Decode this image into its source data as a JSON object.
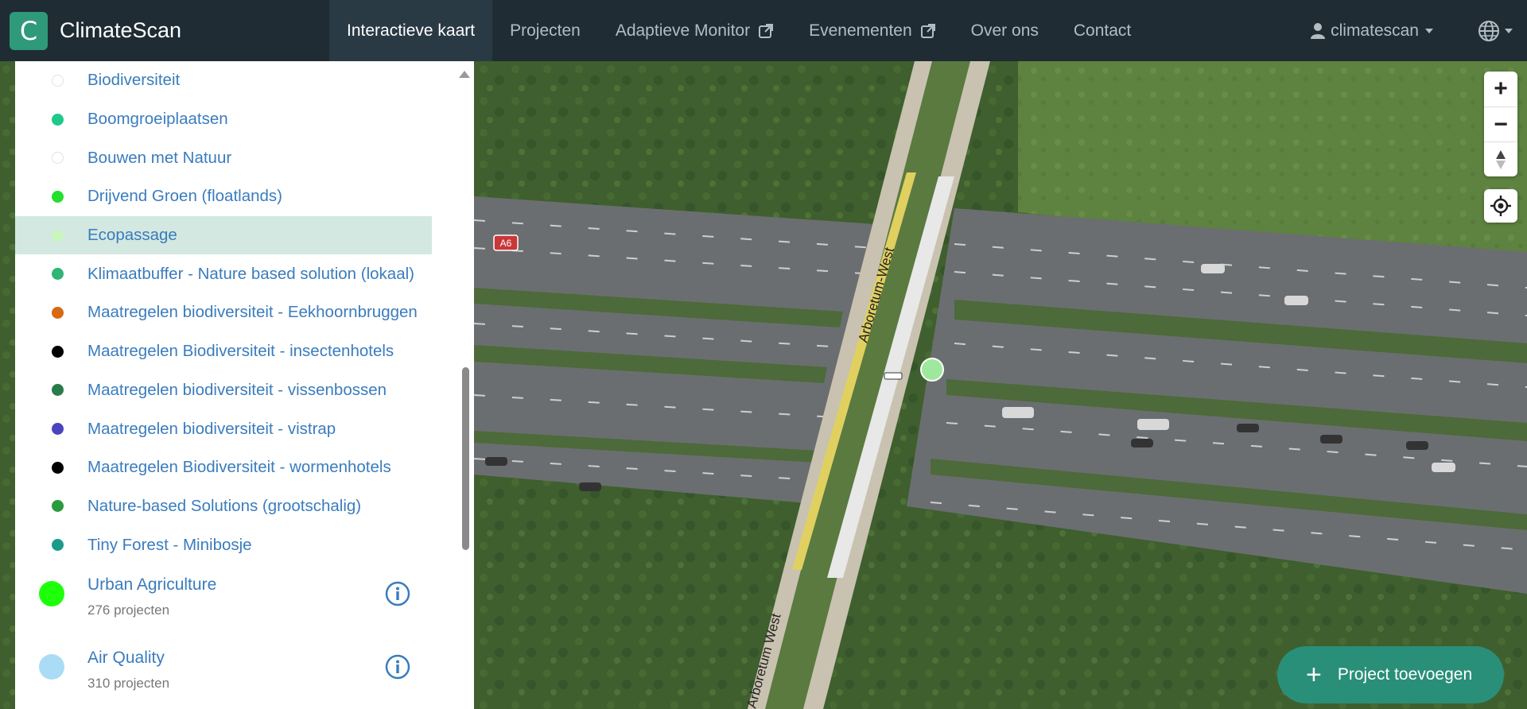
{
  "brand": {
    "logo_letter": "C",
    "name": "ClimateScan"
  },
  "nav": {
    "items": [
      {
        "label": "Interactieve kaart",
        "active": true
      },
      {
        "label": "Projecten"
      },
      {
        "label": "Adaptieve Monitor",
        "external": true
      },
      {
        "label": "Evenementen",
        "external": true
      },
      {
        "label": "Over ons"
      },
      {
        "label": "Contact"
      }
    ],
    "user": "climatescan"
  },
  "sidebar": {
    "items": [
      {
        "label": "Biodiversiteit",
        "color": "#ffffff"
      },
      {
        "label": "Boomgroeiplaatsen",
        "color": "#1ec98a"
      },
      {
        "label": "Bouwen met Natuur",
        "color": "#ffffff"
      },
      {
        "label": "Drijvend Groen (floatlands)",
        "color": "#22e02c"
      },
      {
        "label": "Ecopassage",
        "color": "#c8f5c0"
      },
      {
        "label": "Klimaatbuffer - Nature based solution (lokaal)",
        "color": "#2fb575"
      },
      {
        "label": "Maatregelen biodiversiteit - Eekhoornbruggen",
        "color": "#d66a10"
      },
      {
        "label": "Maatregelen Biodiversiteit - insectenhotels",
        "color": "#000000"
      },
      {
        "label": "Maatregelen biodiversiteit - vissenbossen",
        "color": "#2a7a4a"
      },
      {
        "label": "Maatregelen biodiversiteit - vistrap",
        "color": "#4a44c0"
      },
      {
        "label": "Maatregelen Biodiversiteit - wormenhotels",
        "color": "#000000"
      },
      {
        "label": "Nature-based Solutions (grootschalig)",
        "color": "#2a9a3c"
      },
      {
        "label": "Tiny Forest - Minibosje",
        "color": "#1a9a8a"
      }
    ],
    "categories": [
      {
        "title": "Urban Agriculture",
        "sub": "276 projecten",
        "color": "#1eff0a"
      },
      {
        "title": "Air Quality",
        "sub": "310 projecten",
        "color": "#aadcf5"
      }
    ]
  },
  "map": {
    "road_label_1": "Arboretum-West",
    "road_label_2": "Arboretum West",
    "highway_shield": "A6"
  },
  "controls": {
    "zoom_in": "+",
    "zoom_out": "−"
  },
  "add_button": {
    "label": "Project toevoegen"
  }
}
